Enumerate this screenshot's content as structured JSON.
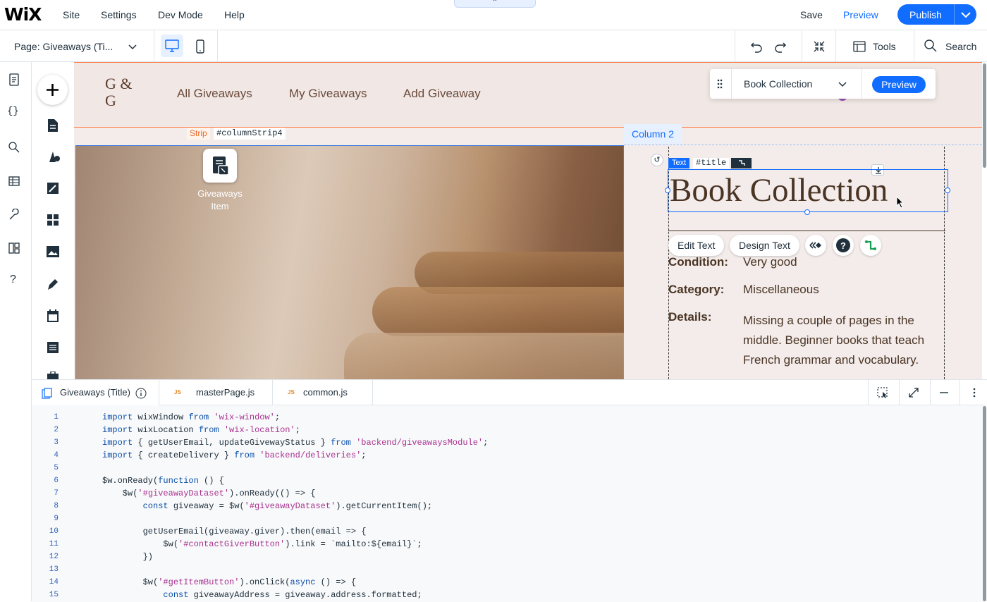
{
  "topbar": {
    "logo": "WiX",
    "menu": [
      "Site",
      "Settings",
      "Dev Mode",
      "Help"
    ],
    "save": "Save",
    "preview": "Preview",
    "publish": "Publish"
  },
  "secondbar": {
    "page_label": "Page:",
    "page_name": "Giveaways (Ti...",
    "tools": "Tools",
    "search": "Search"
  },
  "canvas": {
    "monogram": "G & G",
    "nav": [
      "All Giveaways",
      "My Giveaways",
      "Add Giveaway"
    ],
    "strip_tag": "Strip",
    "strip_id": "#columnStrip4",
    "column_tag": "Column 2",
    "item_label": "Giveaways Item",
    "text_tag": "Text",
    "title_id": "#title",
    "title": "Book Collection",
    "edit_text": "Edit Text",
    "design_text": "Design Text",
    "fields": [
      {
        "label": "Condition:",
        "value": "Very good"
      },
      {
        "label": "Category:",
        "value": "Miscellaneous"
      },
      {
        "label": "Details:",
        "value": "Missing a couple of pages in the middle. Beginner books that teach French grammar and vocabulary."
      }
    ],
    "dataset_select": "Book Collection",
    "float_preview": "Preview"
  },
  "code_panel": {
    "tabs": [
      {
        "label": "Giveaways (Title)",
        "active": true
      },
      {
        "label": "masterPage.js",
        "badge": "JS"
      },
      {
        "label": "common.js",
        "badge": "JS"
      }
    ],
    "lines": [
      {
        "n": "1",
        "text": "import wixWindow from 'wix-window';"
      },
      {
        "n": "2",
        "text": "import wixLocation from 'wix-location';"
      },
      {
        "n": "3",
        "text": "import { getUserEmail, updateGivewayStatus } from 'backend/giveawaysModule';"
      },
      {
        "n": "4",
        "text": "import { createDelivery } from 'backend/deliveries';"
      },
      {
        "n": "5",
        "text": ""
      },
      {
        "n": "6",
        "text": "$w.onReady(function () {"
      },
      {
        "n": "7",
        "text": "    $w('#giveawayDataset').onReady(() => {"
      },
      {
        "n": "8",
        "text": "        const giveaway = $w('#giveawayDataset').getCurrentItem();"
      },
      {
        "n": "9",
        "text": ""
      },
      {
        "n": "10",
        "text": "        getUserEmail(giveaway.giver).then(email => {"
      },
      {
        "n": "11",
        "text": "            $w('#contactGiverButton').link = `mailto:${email}`;"
      },
      {
        "n": "12",
        "text": "        })"
      },
      {
        "n": "13",
        "text": ""
      },
      {
        "n": "14",
        "text": "        $w('#getItemButton').onClick(async () => {"
      },
      {
        "n": "15",
        "text": "            const giveawayAddress = giveaway.address.formatted;"
      }
    ]
  },
  "colors": {
    "accent": "#116dff",
    "brown_text": "#4a3424",
    "strip_orange": "#ff7a3f"
  }
}
